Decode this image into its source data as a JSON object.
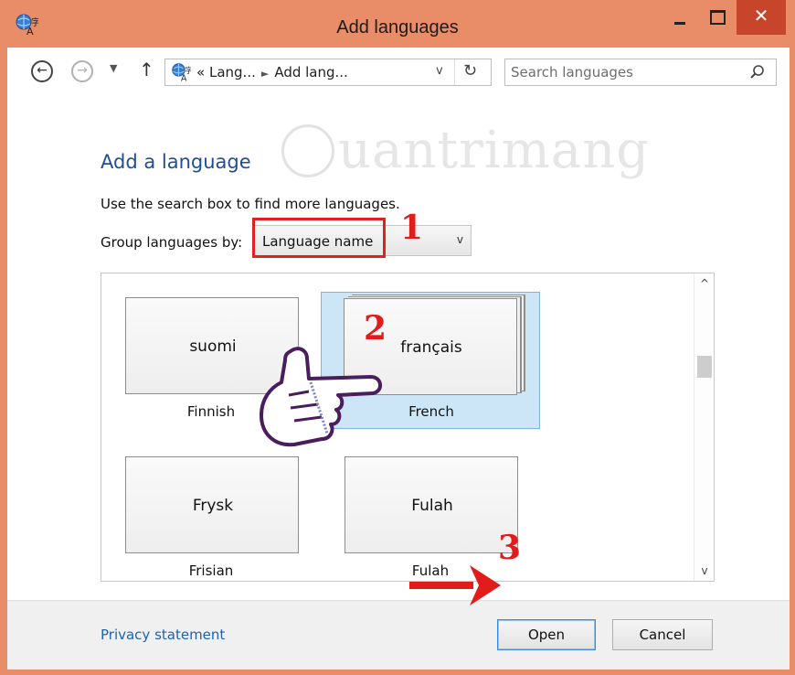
{
  "window": {
    "title": "Add languages",
    "close_glyph": "✕",
    "accent_color": "#e98c68",
    "close_color": "#c7462b"
  },
  "nav": {
    "back_glyph": "←",
    "forward_glyph": "→",
    "recent_glyph": "▼",
    "up_glyph": "↑",
    "address": {
      "prefix": "«",
      "crumb1": "Lang...",
      "separator": "►",
      "crumb2": "Add lang...",
      "dropdown_glyph": "v",
      "refresh_glyph": "↻"
    },
    "search": {
      "placeholder": "Search languages"
    }
  },
  "content": {
    "heading": "Add a language",
    "help_text": "Use the search box to find more languages.",
    "group_label": "Group languages by:",
    "group_value": "Language name",
    "group_arrow": "v",
    "watermark": "uantrimang",
    "annotations": {
      "step1": "1",
      "step2": "2",
      "step3": "3"
    },
    "languages": [
      {
        "native": "suomi",
        "english": "Finnish",
        "selected": false
      },
      {
        "native": "français",
        "english": "French",
        "selected": true
      },
      {
        "native": "Frysk",
        "english": "Frisian",
        "selected": false
      },
      {
        "native": "Fulah",
        "english": "Fulah",
        "selected": false
      }
    ],
    "scroll": {
      "up_glyph": "^",
      "down_glyph": "v",
      "position_fraction": 0.25
    }
  },
  "footer": {
    "privacy_link": "Privacy statement",
    "open_label": "Open",
    "cancel_label": "Cancel"
  },
  "icons": {
    "app": "language-globe-icon",
    "search": "magnifier-icon",
    "hand": "pointing-hand-icon",
    "arrow": "red-arrow-icon"
  }
}
